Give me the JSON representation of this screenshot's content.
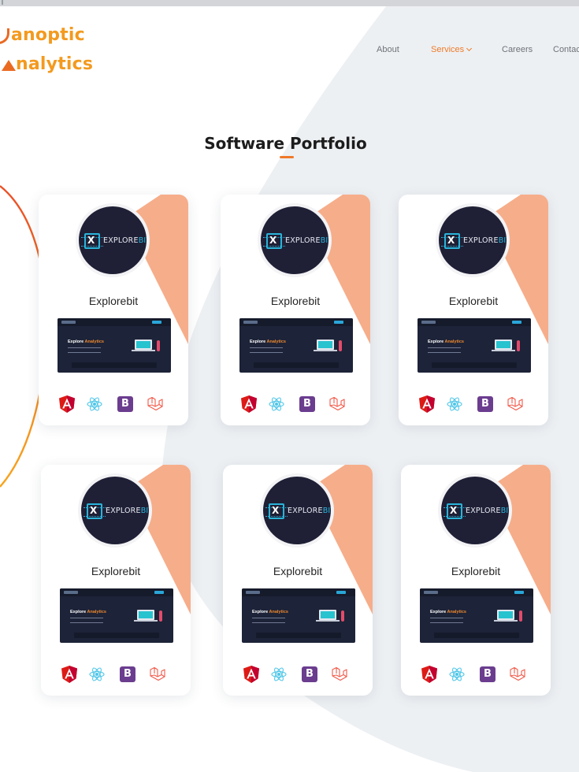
{
  "logo": {
    "line1": "anoptic",
    "line2": "nalytics"
  },
  "nav": {
    "items": [
      {
        "label": "About"
      },
      {
        "label": "Services"
      },
      {
        "label": "Careers"
      },
      {
        "label": "Contac"
      }
    ]
  },
  "section": {
    "title": "Software Portfolio"
  },
  "cards": [
    {
      "name": "Explorebit",
      "brand_left": "EXPLORE",
      "brand_right": "BIT",
      "chip": "X",
      "preview_title_a": "Explore ",
      "preview_title_b": "Analytics"
    },
    {
      "name": "Explorebit",
      "brand_left": "EXPLORE",
      "brand_right": "BIT",
      "chip": "X",
      "preview_title_a": "Explore ",
      "preview_title_b": "Analytics"
    },
    {
      "name": "Explorebit",
      "brand_left": "EXPLORE",
      "brand_right": "BIT",
      "chip": "X",
      "preview_title_a": "Explore ",
      "preview_title_b": "Analytics"
    },
    {
      "name": "Explorebit",
      "brand_left": "EXPLORE",
      "brand_right": "BIT",
      "chip": "X",
      "preview_title_a": "Explore ",
      "preview_title_b": "Analytics"
    },
    {
      "name": "Explorebit",
      "brand_left": "EXPLORE",
      "brand_right": "BIT",
      "chip": "X",
      "preview_title_a": "Explore ",
      "preview_title_b": "Analytics"
    },
    {
      "name": "Explorebit",
      "brand_left": "EXPLORE",
      "brand_right": "BIT",
      "chip": "X",
      "preview_title_a": "Explore ",
      "preview_title_b": "Analytics"
    }
  ],
  "tech_icons": [
    "angular-icon",
    "react-icon",
    "bootstrap-icon",
    "laravel-icon"
  ],
  "tech_labels": {
    "bootstrap": "B",
    "angular": "A"
  },
  "colors": {
    "accent": "#ef7a2a",
    "logo": "#f39a1f",
    "card_deco": "#f6ad8a",
    "background_shape": "#edf0f3",
    "arc": "#f0782a"
  }
}
